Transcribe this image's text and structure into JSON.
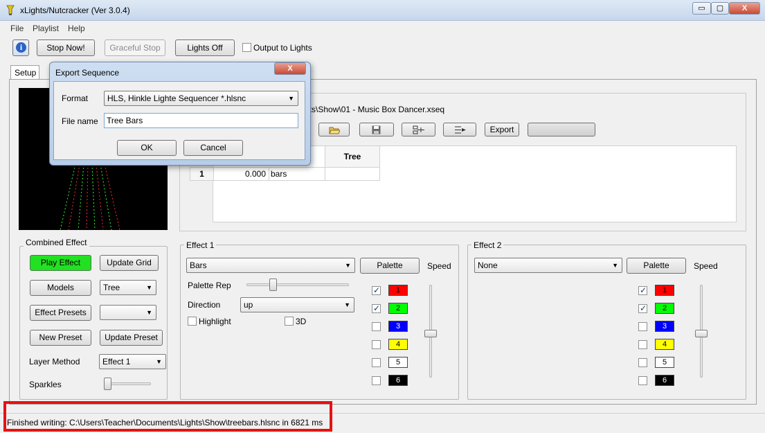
{
  "window": {
    "title": "xLights/Nutcracker  (Ver 3.0.4)",
    "minimize_label": "▭",
    "maximize_label": "▢",
    "close_label": "X"
  },
  "menu": [
    "File",
    "Playlist",
    "Help"
  ],
  "toolbar": {
    "stop_now": "Stop Now!",
    "graceful_stop": "Graceful Stop",
    "lights_off": "Lights Off",
    "output_to_lights": "Output to Lights",
    "info_icon": "i"
  },
  "tabs": {
    "setup": "Setup"
  },
  "sequence": {
    "file_path": "hts\\Show\\01 - Music Box Dancer.xseq",
    "export_label": "Export"
  },
  "grid": {
    "header": "Tree",
    "rows": [
      {
        "num": "1",
        "time": "0.000",
        "effect": "bars"
      }
    ]
  },
  "combined": {
    "label": "Combined Effect",
    "play_effect": "Play Effect",
    "update_grid": "Update Grid",
    "models": "Models",
    "model_value": "Tree",
    "effect_presets": "Effect Presets",
    "preset_value": "",
    "new_preset": "New Preset",
    "update_preset": "Update Preset",
    "layer_method_label": "Layer Method",
    "layer_method_value": "Effect 1",
    "sparkles_label": "Sparkles"
  },
  "effect1": {
    "label": "Effect 1",
    "effect_value": "Bars",
    "palette": "Palette",
    "speed": "Speed",
    "palette_rep": "Palette Rep",
    "direction_label": "Direction",
    "direction_value": "up",
    "highlight": "Highlight",
    "three_d": "3D",
    "colors": [
      {
        "num": "1",
        "checked": true,
        "color": "#ff0000"
      },
      {
        "num": "2",
        "checked": true,
        "color": "#00ff00"
      },
      {
        "num": "3",
        "checked": false,
        "color": "#0000ff"
      },
      {
        "num": "4",
        "checked": false,
        "color": "#ffff00"
      },
      {
        "num": "5",
        "checked": false,
        "color": "#ffffff"
      },
      {
        "num": "6",
        "checked": false,
        "color": "#000000"
      }
    ]
  },
  "effect2": {
    "label": "Effect 2",
    "effect_value": "None",
    "palette": "Palette",
    "speed": "Speed",
    "colors": [
      {
        "num": "1",
        "checked": true,
        "color": "#ff0000"
      },
      {
        "num": "2",
        "checked": true,
        "color": "#00ff00"
      },
      {
        "num": "3",
        "checked": false,
        "color": "#0000ff"
      },
      {
        "num": "4",
        "checked": false,
        "color": "#ffff00"
      },
      {
        "num": "5",
        "checked": false,
        "color": "#ffffff"
      },
      {
        "num": "6",
        "checked": false,
        "color": "#000000"
      }
    ]
  },
  "dialog": {
    "title": "Export Sequence",
    "close_label": "X",
    "format_label": "Format",
    "format_value": "HLS, Hinkle Lighte Sequencer *.hlsnc",
    "file_name_label": "File name",
    "file_name_value": "Tree Bars",
    "ok": "OK",
    "cancel": "Cancel"
  },
  "status": {
    "text": "Finished writing: C:\\Users\\Teacher\\Documents\\Lights\\Show\\treebars.hlsnc in 6821 ms"
  }
}
